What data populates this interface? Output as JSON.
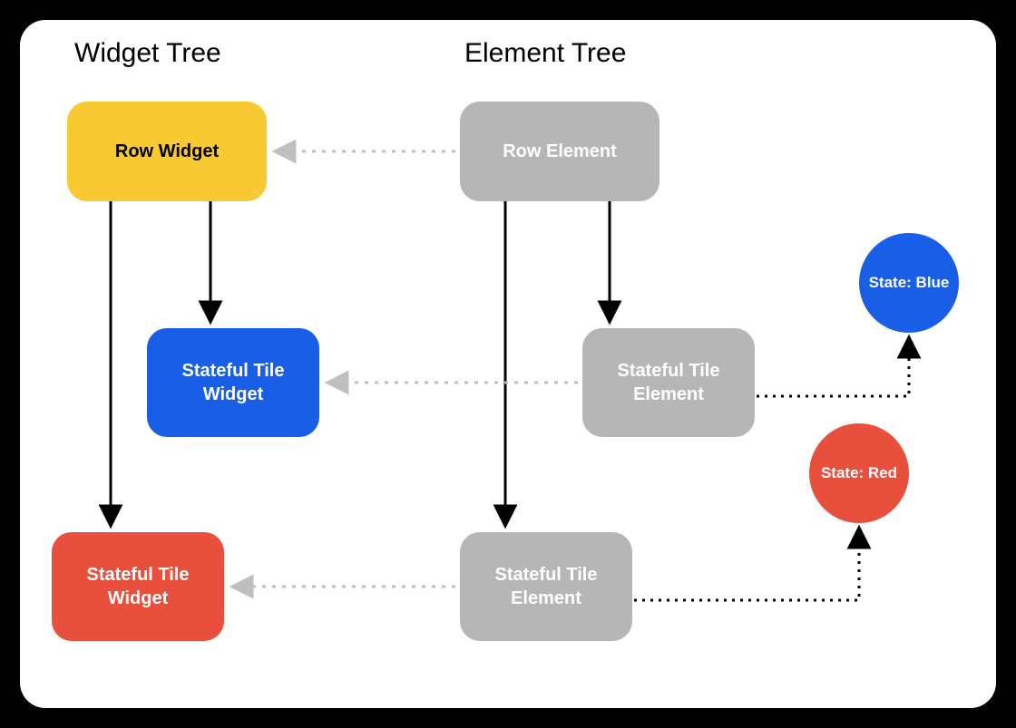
{
  "headings": {
    "widget_tree": "Widget Tree",
    "element_tree": "Element Tree"
  },
  "nodes": {
    "row_widget": "Row Widget",
    "stateful_tile_widget_blue": "Stateful Tile Widget",
    "stateful_tile_widget_red": "Stateful Tile Widget",
    "row_element": "Row Element",
    "stateful_tile_element_1": "Stateful Tile Element",
    "stateful_tile_element_2": "Stateful Tile Element"
  },
  "states": {
    "blue": "State: Blue",
    "red": "State: Red"
  },
  "colors": {
    "yellow": "#f9c934",
    "blue": "#195ee6",
    "red": "#e94f3d",
    "grey": "#b6b6b6",
    "black": "#000000",
    "white": "#ffffff"
  }
}
